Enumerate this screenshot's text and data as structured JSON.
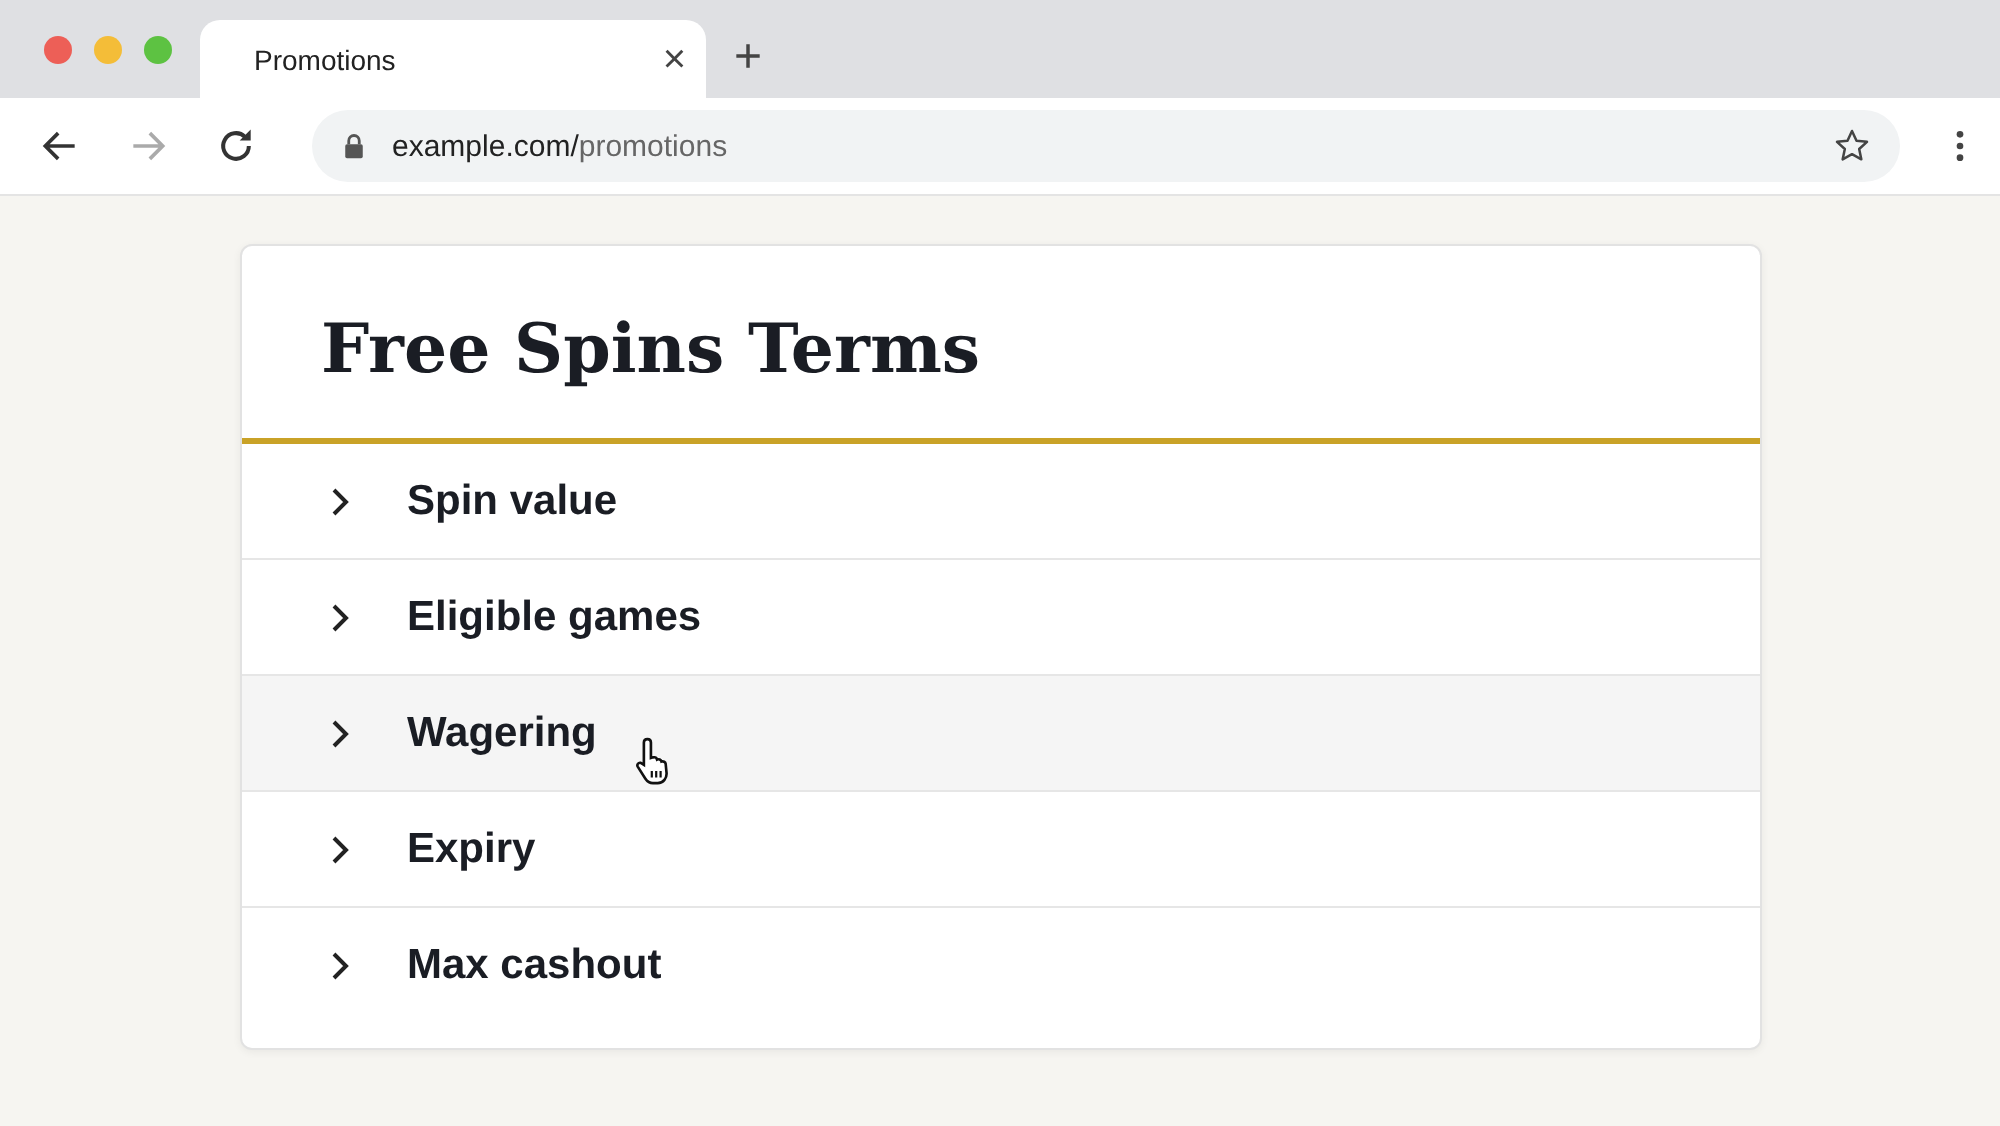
{
  "browser": {
    "tab": {
      "title": "Promotions",
      "close": "×",
      "selected": true
    },
    "new_tab": "+",
    "address": {
      "host": "example.com/",
      "path": "promotions"
    }
  },
  "card": {
    "title": "Free Spins Terms",
    "items": [
      {
        "label": "Spin value",
        "expanded": false,
        "hovered": false
      },
      {
        "label": "Eligible games",
        "expanded": false,
        "hovered": false
      },
      {
        "label": "Wagering",
        "expanded": false,
        "hovered": true
      },
      {
        "label": "Expiry",
        "expanded": false,
        "hovered": false
      },
      {
        "label": "Max cashout",
        "expanded": false,
        "hovered": false
      }
    ]
  }
}
